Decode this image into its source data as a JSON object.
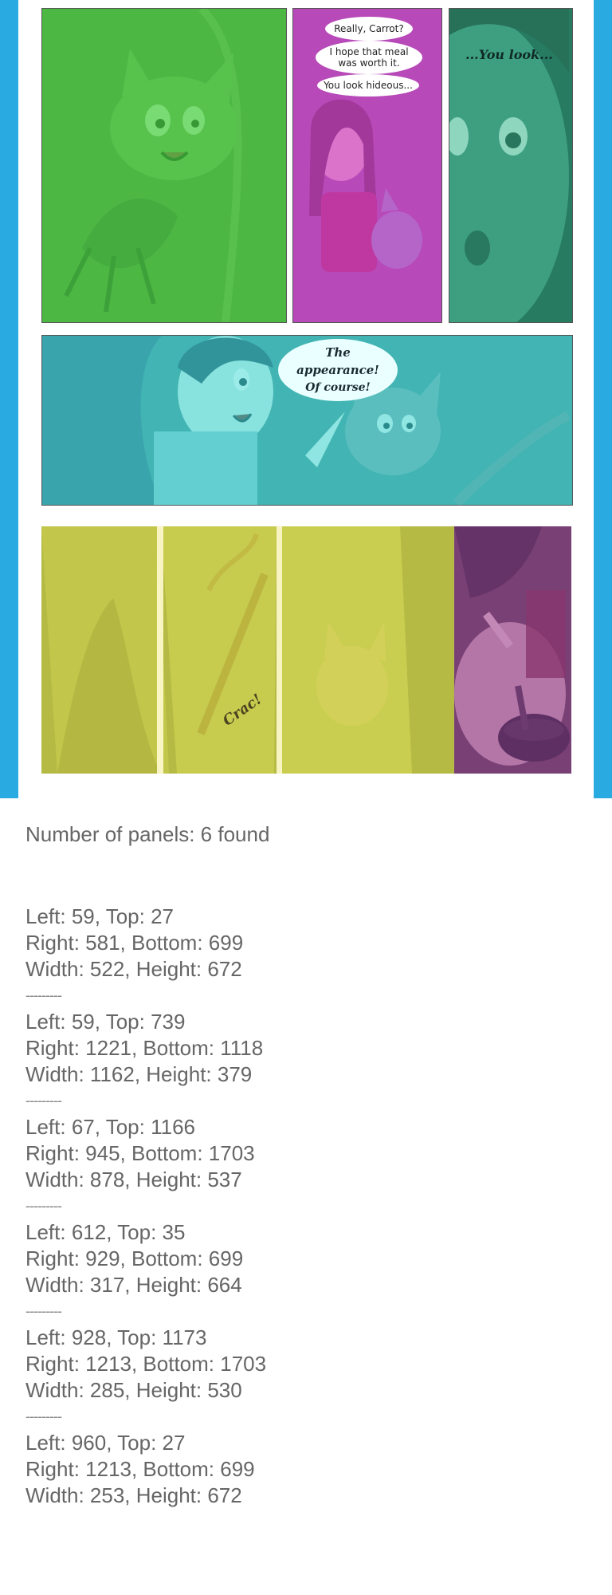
{
  "comic": {
    "bubbles": {
      "b1": "Really, Carrot?",
      "b2": "I hope that meal was worth it.",
      "b3": "You look hideous...",
      "b4": "...You look...",
      "b5": "The appearance!",
      "b6": "Of course!",
      "sfx": "Crac!"
    },
    "overlay_colors": {
      "panel_1": "#3dcc3d",
      "panel_2": "#d13fd6",
      "panel_3": "#2fb387",
      "panel_4": "#38d9d4",
      "panel_5": "#f0f04a",
      "panel_6": "#9b3fb0"
    }
  },
  "info": {
    "count_text": "Number of panels: 6 found",
    "separator": "---------",
    "records": [
      {
        "l1": "Left: 59, Top: 27",
        "l2": "Right: 581, Bottom: 699",
        "l3": "Width: 522, Height: 672"
      },
      {
        "l1": "Left: 59, Top: 739",
        "l2": "Right: 1221, Bottom: 1118",
        "l3": "Width: 1162, Height: 379"
      },
      {
        "l1": "Left: 67, Top: 1166",
        "l2": "Right: 945, Bottom: 1703",
        "l3": "Width: 878, Height: 537"
      },
      {
        "l1": "Left: 612, Top: 35",
        "l2": "Right: 929, Bottom: 699",
        "l3": "Width: 317, Height: 664"
      },
      {
        "l1": "Left: 928, Top: 1173",
        "l2": "Right: 1213, Bottom: 1703",
        "l3": "Width: 285, Height: 530"
      },
      {
        "l1": "Left: 960, Top: 27",
        "l2": "Right: 1213, Bottom: 699",
        "l3": "Width: 253, Height: 672"
      }
    ]
  }
}
